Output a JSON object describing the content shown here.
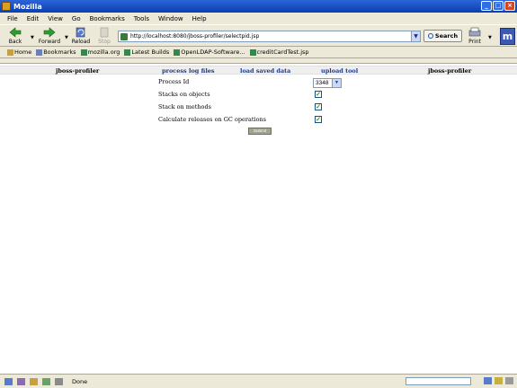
{
  "window": {
    "title": "Mozilla",
    "buttons": [
      "_",
      "□",
      "×"
    ]
  },
  "menu": [
    "File",
    "Edit",
    "View",
    "Go",
    "Bookmarks",
    "Tools",
    "Window",
    "Help"
  ],
  "toolbar": {
    "back": "Back",
    "forward": "Forward",
    "reload": "Reload",
    "stop": "Stop",
    "url": "http://localhost:8080/jboss-profiler/selectpid.jsp",
    "search": "Search",
    "print": "Print",
    "logo": "m"
  },
  "personal": [
    "Home",
    "Bookmarks",
    "mozilla.org",
    "Latest Builds",
    "OpenLDAP-Software...",
    "creditCardTest.jsp"
  ],
  "nav": {
    "left_title": "jboss-profiler",
    "links": [
      "process log files",
      "load saved data",
      "upload tool"
    ],
    "right_title": "jboss-profiler"
  },
  "form": {
    "process_id_label": "Process Id",
    "process_id_value": "3348",
    "stacks_on_objects_label": "Stacks on objects",
    "stacks_on_methods_label": "Stack on methods",
    "gc_label": "Calculate releases on GC operations",
    "checked": "✓",
    "submit": "Submit"
  },
  "status": {
    "text": "Done"
  },
  "colors": {
    "titlebar": "#0a3fb0",
    "chrome": "#ece9d8",
    "link": "#1c3a88",
    "check": "#21a121"
  }
}
